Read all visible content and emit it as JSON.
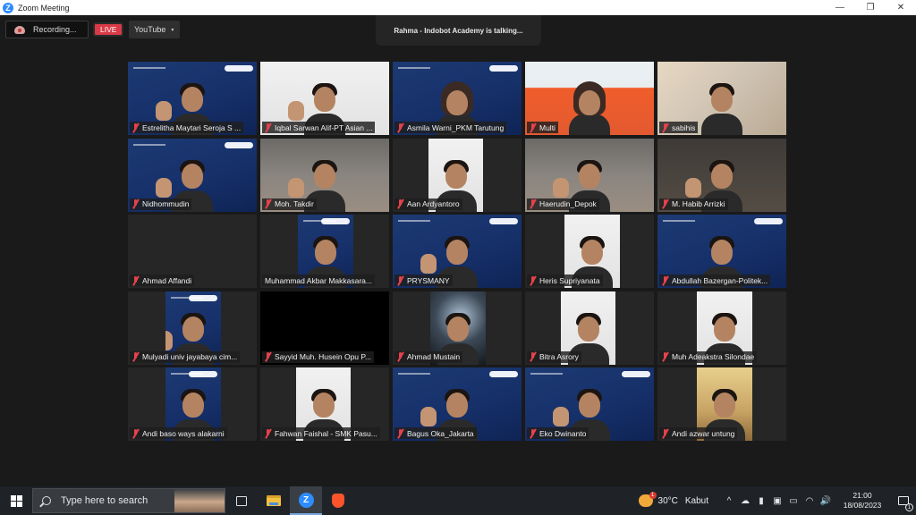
{
  "window": {
    "title": "Zoom Meeting",
    "controls": {
      "minimize": "—",
      "maximize": "❐",
      "close": "✕"
    }
  },
  "meeting": {
    "recording_label": "Recording...",
    "live_label": "LIVE",
    "stream_target": "YouTube",
    "stream_caret": "▾",
    "talking_indicator": "Rahma - Indobot Academy is talking...",
    "accent_color": "#2d8cff",
    "live_color": "#d93a47",
    "muted_icon_color": "#e5424d"
  },
  "participants": [
    {
      "name": "Estrelitha Maytari Seroja S ...",
      "muted": true,
      "video_bg": "blue"
    },
    {
      "name": "Iqbal Sarwan Alif-PT Asian ...",
      "muted": true,
      "video_bg": "white"
    },
    {
      "name": "Asmila Warni_PKM Tarutung",
      "muted": true,
      "video_bg": "blue"
    },
    {
      "name": "Multi",
      "muted": true,
      "video_bg": "orange"
    },
    {
      "name": "sabihis",
      "muted": true,
      "video_bg": "cream"
    },
    {
      "name": "Nidhommudin",
      "muted": true,
      "video_bg": "blue"
    },
    {
      "name": "Moh. Takdir",
      "muted": true,
      "video_bg": "room"
    },
    {
      "name": "Aan Ardyantoro",
      "muted": true,
      "video_bg": "white"
    },
    {
      "name": "Haerudin_Depok",
      "muted": true,
      "video_bg": "room"
    },
    {
      "name": "M. Habib Arrizki",
      "muted": true,
      "video_bg": "dim"
    },
    {
      "name": "Ahmad Affandi",
      "muted": true,
      "video_bg": "none"
    },
    {
      "name": "Muhammad Akbar Makkasara...",
      "muted": false,
      "video_bg": "blue"
    },
    {
      "name": "PRYSMANY",
      "muted": true,
      "video_bg": "blue"
    },
    {
      "name": "Heris Supriyanata",
      "muted": true,
      "video_bg": "white"
    },
    {
      "name": "Abdullah Bazergan-Politek...",
      "muted": true,
      "video_bg": "blue"
    },
    {
      "name": "Mulyadi univ jayabaya cim...",
      "muted": true,
      "video_bg": "blue"
    },
    {
      "name": "Sayyid Muh. Husein Opu P...",
      "muted": true,
      "video_bg": "black"
    },
    {
      "name": "Ahmad Mustain",
      "muted": true,
      "video_bg": "night"
    },
    {
      "name": "Bitra Asrory",
      "muted": true,
      "video_bg": "white"
    },
    {
      "name": "Muh Adeakstra Silondae",
      "muted": true,
      "video_bg": "white"
    },
    {
      "name": "Andi baso ways alakarni",
      "muted": true,
      "video_bg": "blue"
    },
    {
      "name": "Fahwan Faishal - SMK Pasu...",
      "muted": true,
      "video_bg": "white"
    },
    {
      "name": "Bagus Oka_Jakarta",
      "muted": true,
      "video_bg": "blue"
    },
    {
      "name": "Eko Dwinanto",
      "muted": true,
      "video_bg": "blue"
    },
    {
      "name": "Andi azwar untung",
      "muted": true,
      "video_bg": "warm"
    }
  ],
  "taskbar": {
    "search_placeholder": "Type here to search",
    "zoom_letter": "Z",
    "weather_temp": "30°C",
    "weather_condition": "Kabut",
    "weather_badge": "1",
    "time": "21:00",
    "date": "18/08/2023",
    "notification_count": "1",
    "tray_chevron": "^",
    "volume_glyph": "🔊"
  }
}
